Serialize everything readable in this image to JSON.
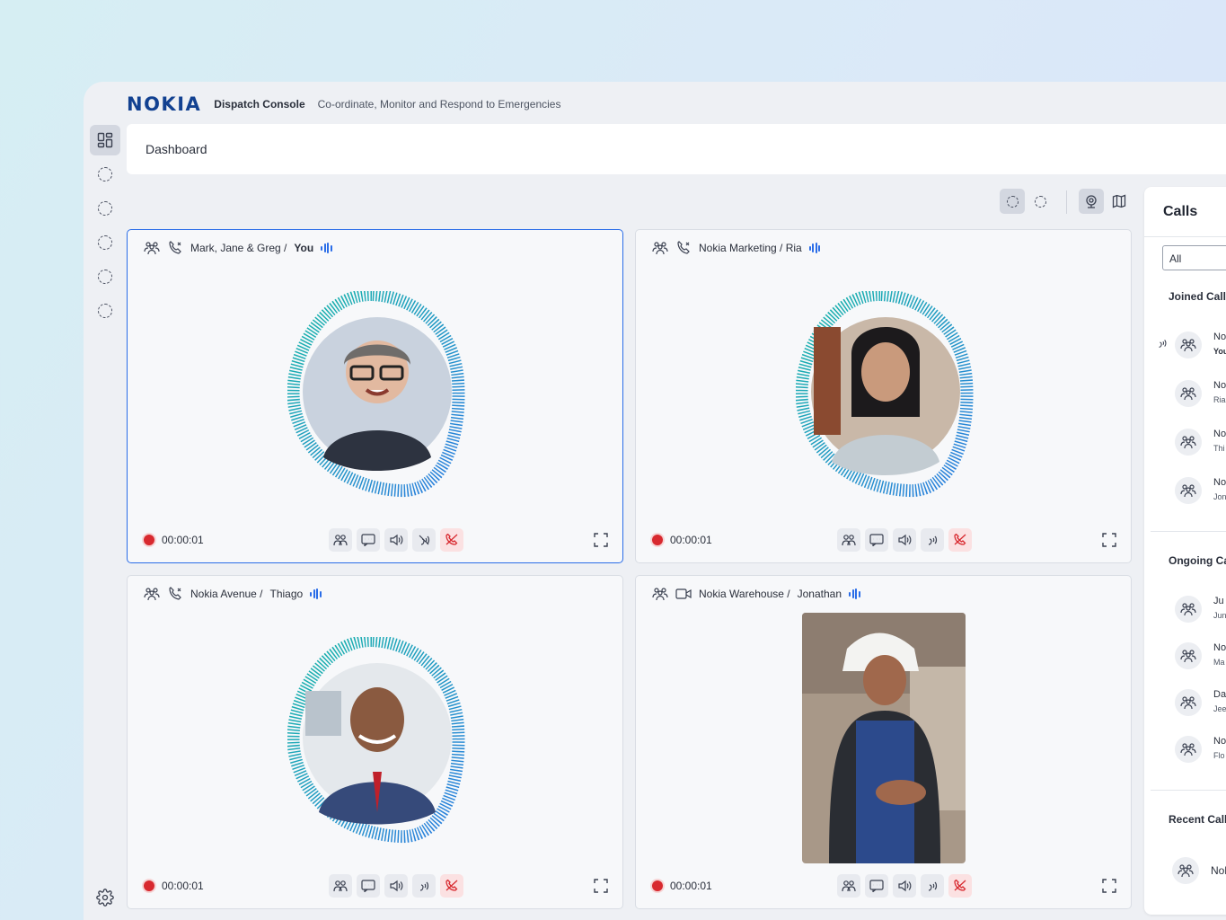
{
  "header": {
    "logo": "NOKIA",
    "product": "Dispatch Console",
    "tagline": "Co-ordinate, Monitor and Respond to Emergencies"
  },
  "nav": {
    "icons": [
      "dashboard-icon",
      "placeholder-icon",
      "placeholder-icon",
      "placeholder-icon",
      "placeholder-icon",
      "placeholder-icon",
      "settings-icon"
    ]
  },
  "page": {
    "title": "Dashboard"
  },
  "toolbar": {
    "icons": [
      "placeholder-icon",
      "placeholder-icon",
      "video-icon",
      "map-icon"
    ]
  },
  "tiles": [
    {
      "title": "Mark, Jane & Greg /",
      "you": "You",
      "timer": "00:00:01",
      "call_type": "ptt",
      "selected": true
    },
    {
      "title": "Nokia Marketing / Ria",
      "you": "",
      "timer": "00:00:01",
      "call_type": "ptt",
      "selected": false
    },
    {
      "title": "Nokia Avenue /",
      "you": "Thiago",
      "timer": "00:00:01",
      "call_type": "ptt",
      "selected": false
    },
    {
      "title": "Nokia Warehouse /",
      "you": "Jonathan",
      "timer": "00:00:01",
      "call_type": "video",
      "selected": false
    }
  ],
  "calls_panel": {
    "title": "Calls",
    "filter": "All",
    "joined_title": "Joined Calls",
    "joined": [
      {
        "line1": "No",
        "line2": "You"
      },
      {
        "line1": "No",
        "line2": "Ria"
      },
      {
        "line1": "No",
        "line2": "Thi"
      },
      {
        "line1": "No",
        "line2": "Jon"
      }
    ],
    "ongoing_title": "Ongoing Ca",
    "ongoing": [
      {
        "line1": "Ju",
        "line2": "Jun"
      },
      {
        "line1": "No",
        "line2": "Ma"
      },
      {
        "line1": "Da",
        "line2": "Jee"
      },
      {
        "line1": "No",
        "line2": "Flo"
      }
    ],
    "recent_title": "Recent Calls",
    "recent": [
      {
        "line1": "Nol"
      }
    ]
  },
  "colors": {
    "accent": "#2a6de8",
    "brand": "#124191",
    "end_call": "#d8292f",
    "wave": "#1fb8c8"
  }
}
